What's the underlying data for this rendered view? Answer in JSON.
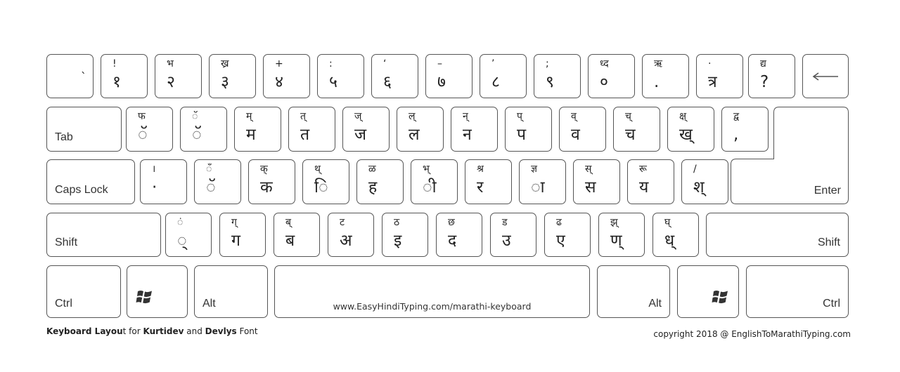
{
  "rows": [
    {
      "name": "number-row",
      "keys": [
        {
          "up": "",
          "down": "`"
        },
        {
          "up": "!",
          "down": "१"
        },
        {
          "up": "भ",
          "down": "२"
        },
        {
          "up": "ख्र",
          "down": "३"
        },
        {
          "up": "+",
          "down": "४"
        },
        {
          "up": ":",
          "down": "५"
        },
        {
          "up": "ʻ",
          "down": "६"
        },
        {
          "up": "–",
          "down": "७"
        },
        {
          "up": "’",
          "down": "८"
        },
        {
          "up": ";",
          "down": "९"
        },
        {
          "up": "ध्द",
          "down": "०"
        },
        {
          "up": "ऋ",
          "down": "."
        },
        {
          "up": "·",
          "down": "त्र"
        },
        {
          "up": "द्य",
          "down": "?"
        }
      ],
      "backspace_icon": "left-arrow-icon"
    },
    {
      "name": "top-row",
      "tab_label": "Tab",
      "keys": [
        {
          "up": "फ",
          "down": "ॅ"
        },
        {
          "up": "ॅ",
          "down": "ॅ"
        },
        {
          "up": "म्",
          "down": "म"
        },
        {
          "up": "त्",
          "down": "त"
        },
        {
          "up": "ज्",
          "down": "ज"
        },
        {
          "up": "ल्",
          "down": "ल"
        },
        {
          "up": "न्",
          "down": "न"
        },
        {
          "up": "प्",
          "down": "प"
        },
        {
          "up": "व्",
          "down": "व"
        },
        {
          "up": "च्",
          "down": "च"
        },
        {
          "up": "क्ष्",
          "down": "ख्"
        },
        {
          "up": "द्व",
          "down": ","
        }
      ]
    },
    {
      "name": "home-row",
      "caps_label": "Caps Lock",
      "keys": [
        {
          "up": "।",
          "down": "·"
        },
        {
          "up": "ँ",
          "down": "ॅ"
        },
        {
          "up": "क्",
          "down": "क"
        },
        {
          "up": "थ्",
          "down": "ि"
        },
        {
          "up": "ळ",
          "down": "ह"
        },
        {
          "up": "भ्",
          "down": "ी"
        },
        {
          "up": "श्र",
          "down": "र"
        },
        {
          "up": "ज्ञ",
          "down": "ा"
        },
        {
          "up": "स्",
          "down": "स"
        },
        {
          "up": "रू",
          "down": "य"
        },
        {
          "up": "/",
          "down": "श्"
        }
      ],
      "enter_label": "Enter"
    },
    {
      "name": "bottom-row",
      "shift_label": "Shift",
      "keys": [
        {
          "up": "ं",
          "down": "्"
        },
        {
          "up": "ग्",
          "down": "ग"
        },
        {
          "up": "ब्",
          "down": "ब"
        },
        {
          "up": "ट",
          "down": "अ"
        },
        {
          "up": "ठ",
          "down": "इ"
        },
        {
          "up": "छ",
          "down": "द"
        },
        {
          "up": "ड",
          "down": "उ"
        },
        {
          "up": "ढ",
          "down": "ए"
        },
        {
          "up": "झ्",
          "down": "ण्"
        },
        {
          "up": "घ्",
          "down": "ध्"
        }
      ],
      "right_shift_label": "Shift"
    },
    {
      "name": "space-row",
      "left_ctrl": "Ctrl",
      "left_win_icon": "windows-logo-icon",
      "left_alt": "Alt",
      "space_text": "www.EasyHindiTyping.com/marathi-keyboard",
      "right_alt": "Alt",
      "right_win_icon": "windows-logo-icon",
      "right_ctrl": "Ctrl"
    }
  ],
  "footer": {
    "left_parts": [
      {
        "text": "Keyboard Layou",
        "bold": true
      },
      {
        "text": "t for ",
        "bold": false
      },
      {
        "text": "Kurtidev",
        "bold": true
      },
      {
        "text": " and ",
        "bold": false
      },
      {
        "text": "Devlys",
        "bold": true
      },
      {
        "text": " Font",
        "bold": false
      }
    ],
    "right": "copyright 2018 @ EnglishToMarathiTyping.com"
  }
}
